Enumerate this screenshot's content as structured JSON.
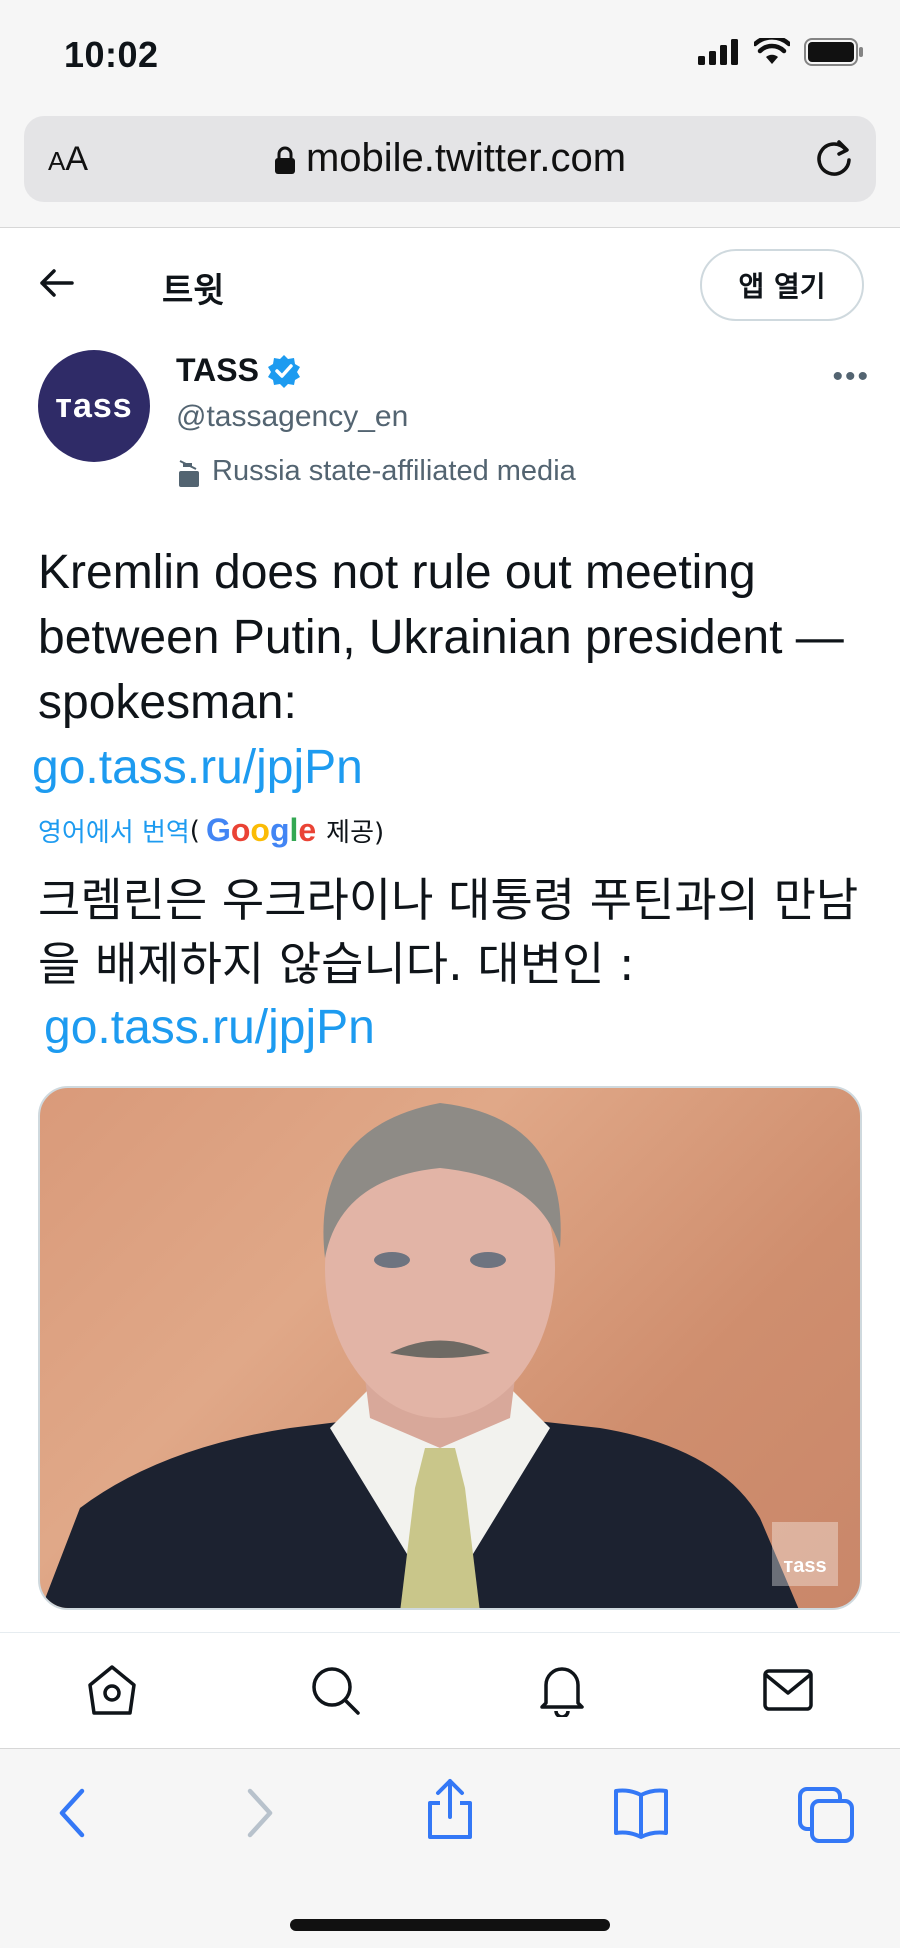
{
  "status": {
    "time": "10:02"
  },
  "browser": {
    "aa_small": "A",
    "aa_big": "A",
    "url": "mobile.twitter.com"
  },
  "header": {
    "title": "트윗",
    "open_app": "앱 열기"
  },
  "author": {
    "avatar_text": "тass",
    "name": "TASS",
    "handle": "@tassagency_en",
    "label": "Russia state-affiliated media"
  },
  "tweet": {
    "text": "Kremlin does not rule out meeting between Putin, Ukrainian president — spokesman:",
    "link": "go.tass.ru/jpjPn",
    "translate_from": "영어에서 번역",
    "translate_open": "(",
    "google": "Google",
    "translate_provided": "제공)",
    "translated_text": "크렘린은 우크라이나 대통령 푸틴과의 만남을 배제하지 않습니다. 대변인 :",
    "translated_link": "go.tass.ru/jpjPn",
    "media_watermark": "тass"
  },
  "colors": {
    "link": "#1d9bf0",
    "verified": "#1d9bf0",
    "safari_blue": "#3478f6"
  },
  "icons": {
    "tabs": [
      "home-icon",
      "search-icon",
      "notifications-icon",
      "messages-icon"
    ],
    "toolbar": [
      "back-icon",
      "forward-icon",
      "share-icon",
      "bookmarks-icon",
      "tabs-icon"
    ]
  }
}
